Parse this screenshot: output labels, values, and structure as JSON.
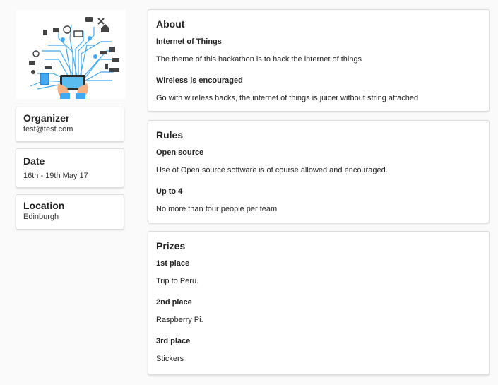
{
  "sidebar": {
    "organizer": {
      "label": "Organizer",
      "value": "test@test.com"
    },
    "date": {
      "label": "Date",
      "value": "16th - 19th May 17"
    },
    "location": {
      "label": "Location",
      "value": "Edinburgh"
    }
  },
  "about": {
    "heading": "About",
    "entries": [
      {
        "title": "Internet of Things",
        "text": "The theme of this hackathon is to hack the internet of things"
      },
      {
        "title": "Wireless is encouraged",
        "text": "Go with wireless hacks, the internet of things is juicer without string attached"
      }
    ]
  },
  "rules": {
    "heading": "Rules",
    "entries": [
      {
        "title": "Open source",
        "text": "Use of Open source software is of course allowed and encouraged."
      },
      {
        "title": "Up to 4",
        "text": "No more than four people per team"
      }
    ]
  },
  "prizes": {
    "heading": "Prizes",
    "entries": [
      {
        "title": "1st place",
        "text": "Trip to Peru."
      },
      {
        "title": "2nd place",
        "text": "Raspberry Pi."
      },
      {
        "title": "3rd place",
        "text": "Stickers"
      }
    ]
  },
  "colors": {
    "accent_blue": "#3fa9f5",
    "icon_dark": "#444444",
    "skin": "#f4b183",
    "card_border": "#dcdcdc"
  },
  "hero_image": {
    "icon": "iot-hand-tablet-illustration"
  }
}
